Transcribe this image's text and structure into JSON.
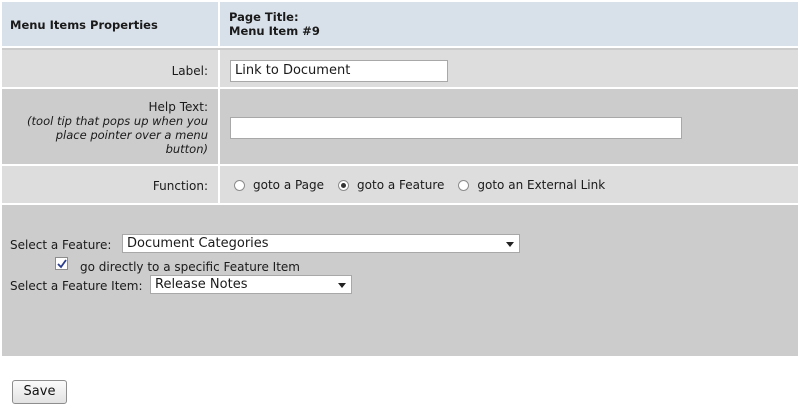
{
  "header": {
    "section_title": "Menu Items Properties",
    "page_title_label": "Page Title:",
    "page_title_value": "Menu Item #9"
  },
  "fields": {
    "label": {
      "label": "Label:",
      "value": "Link to Document"
    },
    "help_text": {
      "label": "Help Text:",
      "note_lines": [
        "(tool tip that pops up when you",
        "place pointer over a menu",
        "button)"
      ],
      "value": ""
    },
    "function": {
      "label": "Function:",
      "options": [
        {
          "label": "goto a Page",
          "selected": false
        },
        {
          "label": "goto a Feature",
          "selected": true
        },
        {
          "label": "goto an External Link",
          "selected": false
        }
      ]
    }
  },
  "feature": {
    "select_label": "Select a Feature:",
    "select_value": "Document Categories",
    "direct_checkbox_label": "go directly to a specific Feature Item",
    "direct_checked": true,
    "item_label": "Select a Feature Item:",
    "item_value": "Release Notes"
  },
  "actions": {
    "save_label": "Save"
  }
}
